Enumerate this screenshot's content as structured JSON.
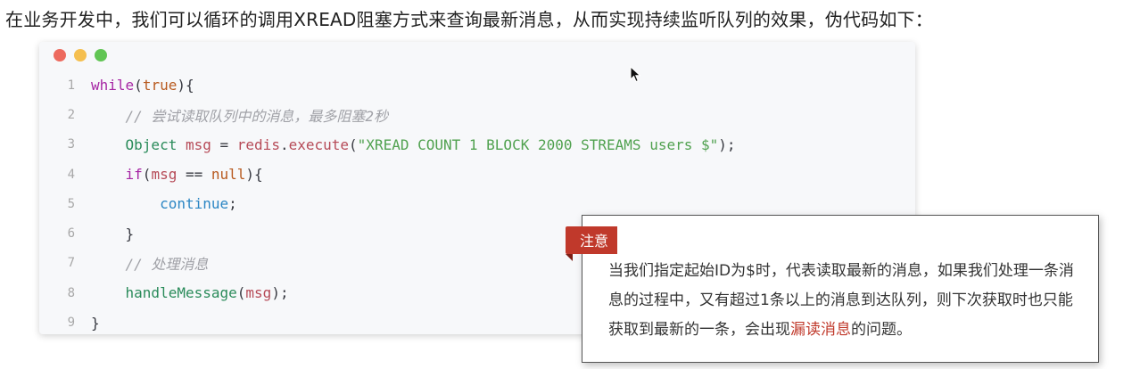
{
  "intro_text": "在业务开发中，我们可以循环的调用XREAD阻塞方式来查询最新消息，从而实现持续监听队列的效果，伪代码如下：",
  "window_dots": [
    {
      "name": "close",
      "color": "#ed6a5e"
    },
    {
      "name": "minimize",
      "color": "#f5bf4f"
    },
    {
      "name": "maximize",
      "color": "#61c554"
    }
  ],
  "code": {
    "lines": [
      {
        "num": "1",
        "indent": "",
        "tokens": [
          {
            "t": "while",
            "c": "kw"
          },
          {
            "t": "(",
            "c": "plain"
          },
          {
            "t": "true",
            "c": "lit"
          },
          {
            "t": "){",
            "c": "plain"
          }
        ]
      },
      {
        "num": "2",
        "indent": "    ",
        "tokens": [
          {
            "t": "// 尝试读取队列中的消息，最多阻塞2秒",
            "c": "cmt"
          }
        ]
      },
      {
        "num": "3",
        "indent": "    ",
        "tokens": [
          {
            "t": "Object",
            "c": "fn"
          },
          {
            "t": " ",
            "c": "plain"
          },
          {
            "t": "msg",
            "c": "var"
          },
          {
            "t": " = ",
            "c": "plain"
          },
          {
            "t": "redis",
            "c": "var"
          },
          {
            "t": ".",
            "c": "plain"
          },
          {
            "t": "execute",
            "c": "var"
          },
          {
            "t": "(",
            "c": "plain"
          },
          {
            "t": "\"XREAD COUNT 1 BLOCK 2000 STREAMS users $\"",
            "c": "str"
          },
          {
            "t": ");",
            "c": "plain"
          }
        ]
      },
      {
        "num": "4",
        "indent": "    ",
        "tokens": [
          {
            "t": "if",
            "c": "kw"
          },
          {
            "t": "(",
            "c": "plain"
          },
          {
            "t": "msg",
            "c": "var"
          },
          {
            "t": " == ",
            "c": "plain"
          },
          {
            "t": "null",
            "c": "lit"
          },
          {
            "t": "){",
            "c": "plain"
          }
        ]
      },
      {
        "num": "5",
        "indent": "        ",
        "tokens": [
          {
            "t": "continue",
            "c": "obj"
          },
          {
            "t": ";",
            "c": "plain"
          }
        ]
      },
      {
        "num": "6",
        "indent": "    ",
        "tokens": [
          {
            "t": "}",
            "c": "plain"
          }
        ]
      },
      {
        "num": "7",
        "indent": "    ",
        "tokens": [
          {
            "t": "// 处理消息",
            "c": "cmt"
          }
        ]
      },
      {
        "num": "8",
        "indent": "    ",
        "tokens": [
          {
            "t": "handleMessage",
            "c": "fn"
          },
          {
            "t": "(",
            "c": "plain"
          },
          {
            "t": "msg",
            "c": "var"
          },
          {
            "t": ");",
            "c": "plain"
          }
        ]
      },
      {
        "num": "9",
        "indent": "",
        "tokens": [
          {
            "t": "}",
            "c": "plain"
          }
        ]
      }
    ]
  },
  "note": {
    "tag": "注意",
    "text_before": "当我们指定起始ID为$时，代表读取最新的消息，如果我们处理一条消息的过程中，又有超过1条以上的消息到达队列，则下次获取时也只能获取到最新的一条，会出现",
    "highlight": "漏读消息",
    "text_after": "的问题。",
    "tag_color": "#c0392b"
  }
}
